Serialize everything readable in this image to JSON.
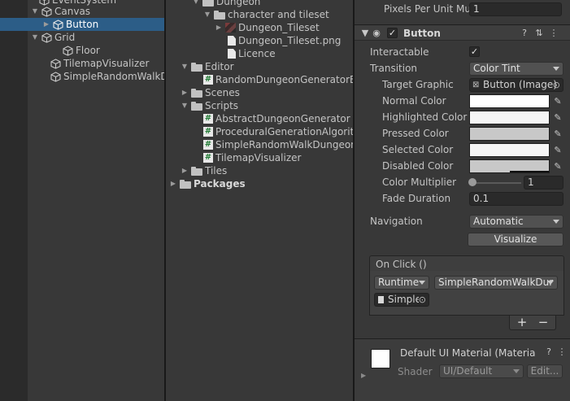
{
  "hierarchy": {
    "items": [
      {
        "label": "EventSystem",
        "selected": false
      },
      {
        "label": "Canvas",
        "selected": false
      },
      {
        "label": "Button",
        "selected": true
      },
      {
        "label": "Grid",
        "selected": false
      },
      {
        "label": "Floor",
        "selected": false
      },
      {
        "label": "TilemapVisualizer",
        "selected": false
      },
      {
        "label": "SimpleRandomWalkD",
        "selected": false
      }
    ]
  },
  "project": {
    "items": [
      {
        "label": "Dungeon",
        "kind": "folder"
      },
      {
        "label": "character and tileset",
        "kind": "folder"
      },
      {
        "label": "Dungeon_Tileset",
        "kind": "tilemap"
      },
      {
        "label": "Dungeon_Tileset.png",
        "kind": "file"
      },
      {
        "label": "Licence",
        "kind": "file"
      },
      {
        "label": "Editor",
        "kind": "folder"
      },
      {
        "label": "RandomDungeonGeneratorEd",
        "kind": "script"
      },
      {
        "label": "Scenes",
        "kind": "folder"
      },
      {
        "label": "Scripts",
        "kind": "folder"
      },
      {
        "label": "AbstractDungeonGenerator",
        "kind": "script"
      },
      {
        "label": "ProceduralGenerationAlgorith",
        "kind": "script"
      },
      {
        "label": "SimpleRandomWalkDungeonG",
        "kind": "script"
      },
      {
        "label": "TilemapVisualizer",
        "kind": "script"
      },
      {
        "label": "Tiles",
        "kind": "folder"
      },
      {
        "label": "Packages",
        "kind": "folder"
      }
    ]
  },
  "inspector": {
    "pixels_per_unit_label": "Pixels Per Unit Mul",
    "pixels_per_unit_value": "1",
    "component_title": "Button",
    "interactable_label": "Interactable",
    "transition_label": "Transition",
    "transition_value": "Color Tint",
    "target_graphic_label": "Target Graphic",
    "target_graphic_value": "Button (Image)",
    "normal_color_label": "Normal Color",
    "highlighted_color_label": "Highlighted Color",
    "pressed_color_label": "Pressed Color",
    "selected_color_label": "Selected Color",
    "disabled_color_label": "Disabled Color",
    "color_multiplier_label": "Color Multiplier",
    "color_multiplier_value": "1",
    "fade_duration_label": "Fade Duration",
    "fade_duration_value": "0.1",
    "navigation_label": "Navigation",
    "navigation_value": "Automatic",
    "visualize_label": "Visualize",
    "on_click_label": "On Click ()",
    "runtime_value": "Runtime",
    "function_value": "SimpleRandomWalkDur",
    "object_value": "Simple",
    "plus_label": "+",
    "minus_label": "−",
    "material_title": "Default UI Material (Materia",
    "shader_label": "Shader",
    "shader_value": "UI/Default",
    "edit_label": "Edit..."
  },
  "colors": {
    "normal": "#ffffff",
    "highlighted": "#f5f5f5",
    "pressed": "#c8c8c8",
    "selected": "#f5f5f5",
    "disabled": "#c8c8c8",
    "selection": "#2c5d87"
  }
}
